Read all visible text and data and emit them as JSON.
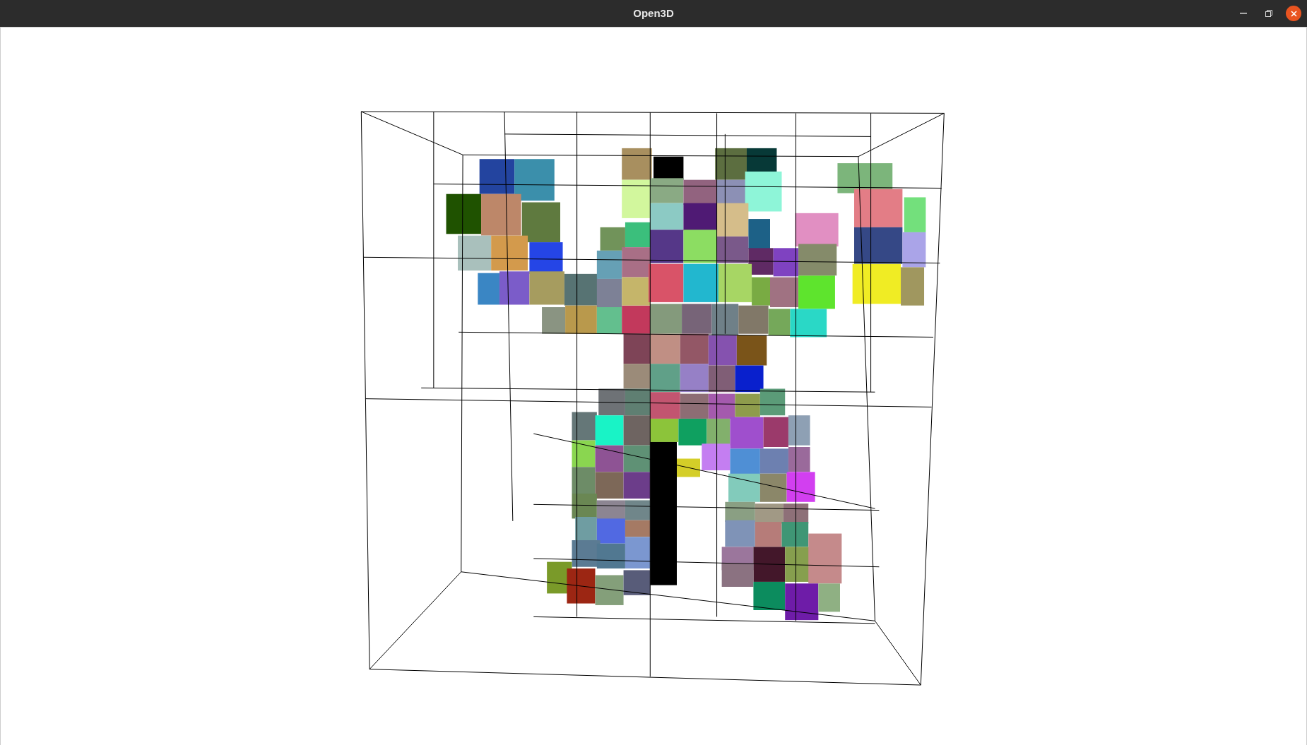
{
  "window": {
    "title": "Open3D"
  }
}
